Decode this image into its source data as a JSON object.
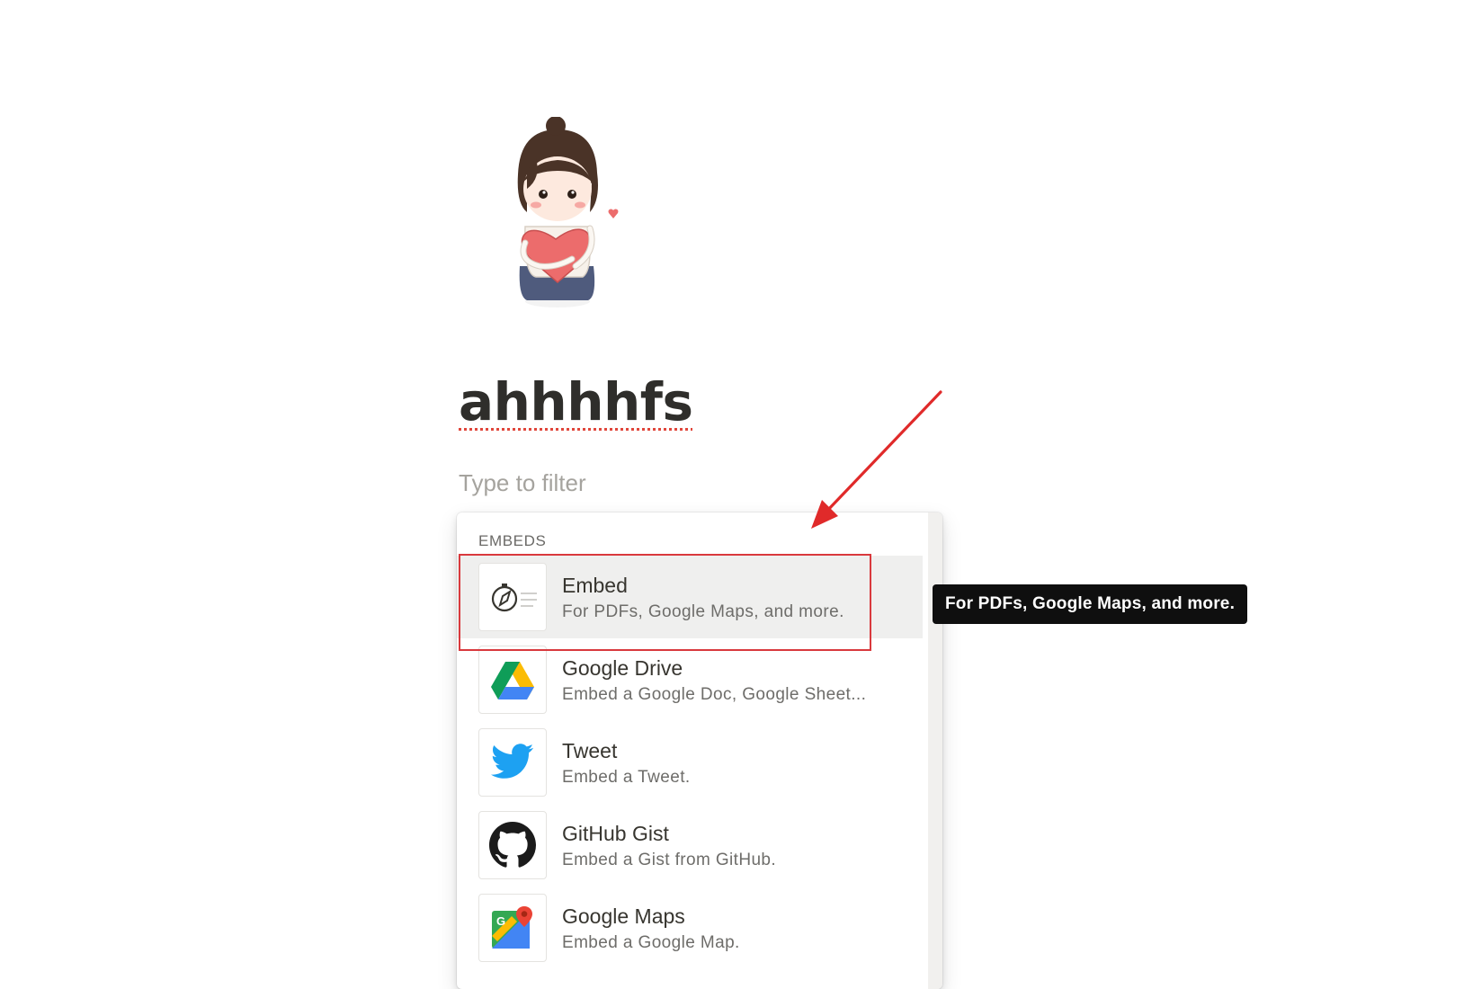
{
  "page": {
    "icon": "girl-holding-heart-illustration",
    "title": "ahhhhfs"
  },
  "filter": {
    "placeholder": "Type to filter"
  },
  "menu": {
    "section_label": "EMBEDS",
    "items": [
      {
        "title": "Embed",
        "description": "For PDFs, Google Maps, and more.",
        "icon": "compass-icon",
        "selected": true
      },
      {
        "title": "Google Drive",
        "description": "Embed a Google Doc, Google Sheet...",
        "icon": "google-drive-icon"
      },
      {
        "title": "Tweet",
        "description": "Embed a Tweet.",
        "icon": "twitter-bird-icon"
      },
      {
        "title": "GitHub Gist",
        "description": "Embed a Gist from GitHub.",
        "icon": "github-icon"
      },
      {
        "title": "Google Maps",
        "description": "Embed a Google Map.",
        "icon": "google-maps-icon"
      }
    ]
  },
  "tooltip": {
    "text": "For PDFs, Google Maps, and more."
  },
  "annotation": {
    "highlight_color": "#d9393d",
    "arrow_color": "#e02a2a"
  }
}
